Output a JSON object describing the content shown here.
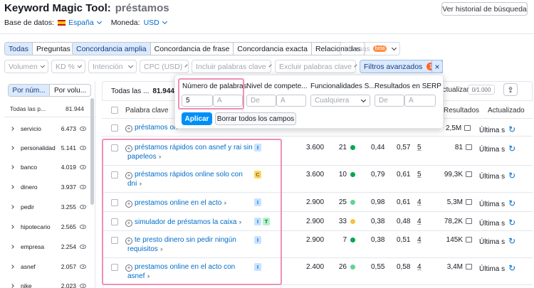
{
  "header": {
    "title": "Keyword Magic Tool:",
    "keyword": "préstamos",
    "history_button": "Ver historial de búsqueda",
    "database_label": "Base de datos:",
    "database_value": "España",
    "currency_label": "Moneda:",
    "currency_value": "USD"
  },
  "match_tabs": {
    "group1": [
      "Todas",
      "Preguntas"
    ],
    "group2": [
      "Concordancia amplia",
      "Concordancia de frase",
      "Concordancia exacta",
      "Relacionadas"
    ]
  },
  "languages": {
    "label": "Idiomas",
    "badge": "beta"
  },
  "filters": {
    "volume": "Volumen",
    "kd": "KD %",
    "intent": "Intención",
    "cpc": "CPC (USD)",
    "include": "Incluir palabras clave",
    "exclude": "Excluir palabras clave",
    "advanced": "Filtros avanzados",
    "advanced_count": "1",
    "clear": "×"
  },
  "advanced_panel": {
    "words_label": "Número de palabras",
    "words_from": "5",
    "words_to_placeholder": "A",
    "competition_label": "Nivel de compete...",
    "competition_from_placeholder": "De",
    "competition_to_placeholder": "A",
    "serp_features_label": "Funcionalidades S...",
    "serp_features_value": "Cualquiera",
    "serp_results_label": "Resultados en SERP",
    "serp_results_from_placeholder": "De",
    "serp_results_to_placeholder": "A",
    "apply_button": "Aplicar",
    "clear_button": "Borrar todos los campos"
  },
  "sidebar": {
    "toggle": [
      "Por núm...",
      "Por volu..."
    ],
    "header_label": "Todas las p...",
    "header_count": "81.944",
    "groups": [
      {
        "name": "servicio",
        "count": "6.473"
      },
      {
        "name": "personalidad",
        "count": "5.141"
      },
      {
        "name": "banco",
        "count": "4.019"
      },
      {
        "name": "dinero",
        "count": "3.937"
      },
      {
        "name": "pedir",
        "count": "3.255"
      },
      {
        "name": "hipotecario",
        "count": "2.565"
      },
      {
        "name": "empresa",
        "count": "2.254"
      },
      {
        "name": "asnef",
        "count": "2.057"
      },
      {
        "name": "nike",
        "count": "2.023"
      }
    ]
  },
  "table": {
    "summary_label": "Todas las ...",
    "summary_count": "81.944",
    "update_label": "Actualizar",
    "pager": "0/1.000",
    "col_keyword": "Palabra clave",
    "col_results": "Resultados",
    "col_updated": "Actualizado",
    "partial_row": {
      "keyword": "préstamos on",
      "results": "2,5M",
      "updated": "Última s"
    },
    "rows": [
      {
        "kw1": "préstamos rápidos con asnef y rai sin",
        "kw2": "papeleos",
        "intent": [
          "I"
        ],
        "volume": "3.600",
        "kd": "21",
        "kd_color": "#00a854",
        "cpc": "0,44",
        "comp": "0,57",
        "sf": "5",
        "results": "81",
        "updated": "Última s"
      },
      {
        "kw1": "préstamos rápidos online solo con",
        "kw2": "dni",
        "intent": [
          "C"
        ],
        "volume": "3.600",
        "kd": "10",
        "kd_color": "#00a854",
        "cpc": "0,79",
        "comp": "0,61",
        "sf": "5",
        "results": "99,3K",
        "updated": "Última s"
      },
      {
        "kw1": "prestamos online en el acto",
        "kw2": "",
        "intent": [
          "I"
        ],
        "volume": "2.900",
        "kd": "25",
        "kd_color": "#5ed495",
        "cpc": "0,98",
        "comp": "0,61",
        "sf": "4",
        "results": "5,3M",
        "updated": "Última s"
      },
      {
        "kw1": "simulador de préstamos la caixa",
        "kw2": "",
        "intent": [
          "I",
          "T"
        ],
        "volume": "2.900",
        "kd": "33",
        "kd_color": "#f5c242",
        "cpc": "0,38",
        "comp": "0,48",
        "sf": "4",
        "results": "78,2K",
        "updated": "Última s"
      },
      {
        "kw1": "te presto dinero sin pedir ningún",
        "kw2": "requisitos",
        "intent": [
          "I"
        ],
        "volume": "2.900",
        "kd": "7",
        "kd_color": "#00a854",
        "cpc": "0,38",
        "comp": "0,51",
        "sf": "4",
        "results": "145K",
        "updated": "Última s"
      },
      {
        "kw1": "prestamos online en el acto con",
        "kw2": "asnef",
        "intent": [
          "I"
        ],
        "volume": "2.400",
        "kd": "26",
        "kd_color": "#5ed495",
        "cpc": "0,55",
        "comp": "0,58",
        "sf": "4",
        "results": "3,4M",
        "updated": "Última s"
      }
    ]
  }
}
